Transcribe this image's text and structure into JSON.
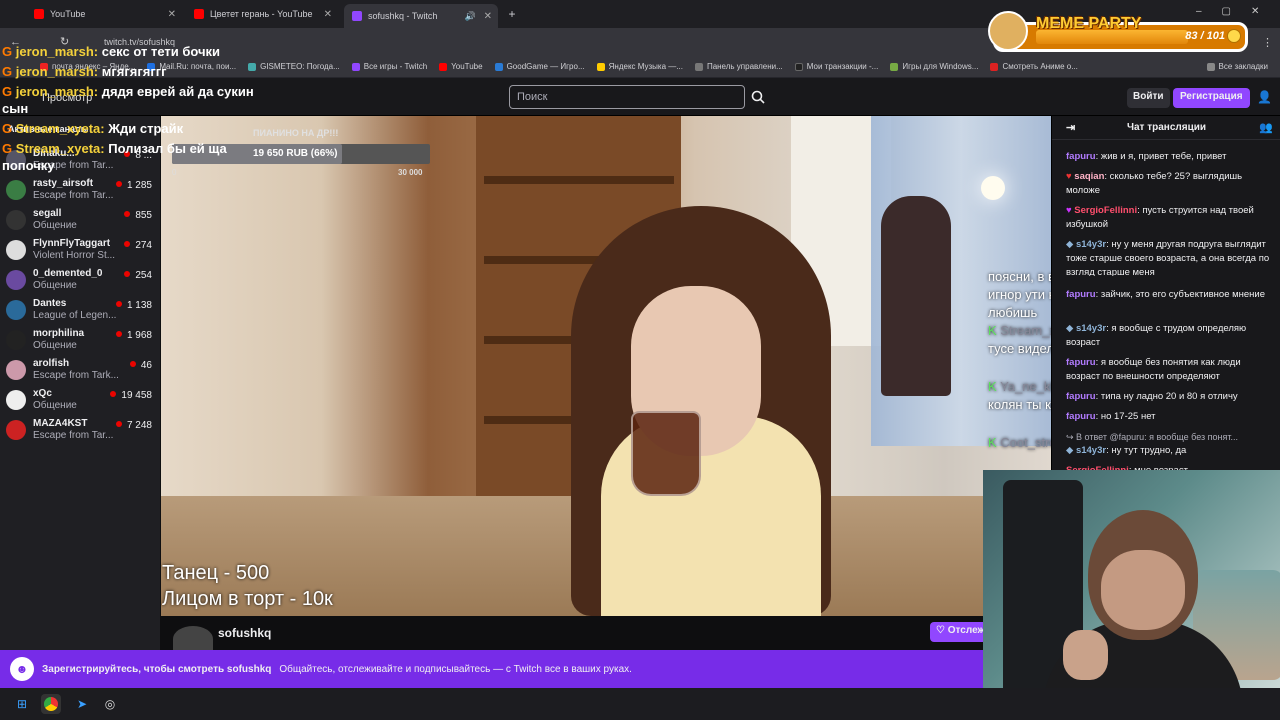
{
  "browser": {
    "tabs": [
      {
        "label": "YouTube"
      },
      {
        "label": "Цветет герань - YouTube"
      },
      {
        "label": "sofushkq - Twitch"
      }
    ],
    "url": "twitch.tv/sofushkq",
    "bookmarks": [
      "почта яндекс – Янде...",
      "Mail.Ru: почта, пои...",
      "GISMETEO: Погода...",
      "Все игры - Twitch",
      "YouTube",
      "GoodGame — Игро...",
      "Яндекс Музыка —...",
      "Панель управлени...",
      "Мои транзакции -...",
      "Игры для Windows...",
      "Смотреть Аниме о..."
    ],
    "all_bookmarks": "Все закладки"
  },
  "twitch": {
    "search_placeholder": "Поиск",
    "login": "Войти",
    "signup": "Регистрация",
    "sidebar_header": "Активные каналы",
    "sidebar_overlay_label": "Просмотр",
    "channels": [
      {
        "name": "Dinaku...",
        "game": "Escape from Tar...",
        "viewers": "8 ..."
      },
      {
        "name": "rasty_airsoft",
        "game": "Escape from Tar...",
        "viewers": "1 285"
      },
      {
        "name": "segall",
        "game": "Общение",
        "viewers": "855"
      },
      {
        "name": "FlynnFlyTaggart",
        "game": "Violent Horror St...",
        "viewers": "274"
      },
      {
        "name": "0_demented_0",
        "game": "Общение",
        "viewers": "254"
      },
      {
        "name": "Dantes",
        "game": "League of Legen...",
        "viewers": "1 138"
      },
      {
        "name": "morphilina",
        "game": "Общение",
        "viewers": "1 968"
      },
      {
        "name": "arolfish",
        "game": "Escape from Tark...",
        "viewers": "46"
      },
      {
        "name": "xQc",
        "game": "Общение",
        "viewers": "19 458"
      },
      {
        "name": "MAZA4KST",
        "game": "Escape from Tar...",
        "viewers": "7 248"
      }
    ],
    "chat_title": "Чат трансляции",
    "chat": [
      {
        "user": "fapuru",
        "text": ": жив и я, привет тебе, привет",
        "color": "#b27cff"
      },
      {
        "user": "saqian",
        "text": ": сколько тебе? 25? выглядишь моложе",
        "color": "#ffb3c7"
      },
      {
        "user": "SergioFellinni",
        "text": ": пусть струится над твоей избушкой",
        "color": "#ff4f6d"
      },
      {
        "user": "s14y3r",
        "text": ": ну у меня другая подруга выглядит тоже старше своего возраста, а она всегда по взгляд старше меня",
        "color": "#8fb4d8"
      },
      {
        "user": "fapuru",
        "text": ": зайчик, это его субъективное мнение",
        "color": "#b27cff"
      },
      {
        "user": "s14y3r",
        "text": ": я вообще с трудом определяю возраст",
        "color": "#8fb4d8"
      },
      {
        "user": "fapuru",
        "text": ": я вообще без понятия как люди возраст по внешности определяют",
        "color": "#b27cff"
      },
      {
        "user": "fapuru",
        "text": ": типа ну ладно 20 и 80 я отличу",
        "color": "#b27cff"
      },
      {
        "user": "fapuru",
        "text": ": но 17-25 нет",
        "color": "#b27cff"
      },
      {
        "user": "",
        "text": "В ответ @fapuru: я вообще без понят...",
        "color": "#adadb8"
      },
      {
        "user": "s14y3r",
        "text": ": ну тут трудно, да",
        "color": "#8fb4d8"
      },
      {
        "user": "SergioFellinni",
        "text": ": мне возраст",
        "color": "#ff4f6d"
      }
    ],
    "channel_name": "sofushkq",
    "follow": "Отслеживать",
    "banner_bold": "Зарегистрируйтесь, чтобы смотреть sofushkq",
    "banner_text": "Общайтесь, отслеживайте и подписывайтесь — с Twitch все в ваших руках."
  },
  "stream": {
    "goal_title": "ПИАНИНО НА ДР!!!",
    "goal_value": "19 650 RUB (66%)",
    "goal_progress": 0.66,
    "goal_min": "0",
    "goal_max": "30 000",
    "menu_line1": "Танец - 500",
    "menu_line2": "Лицом в торт - 10к",
    "right_overlay": [
      {
        "user": "",
        "text": "поясни, в в чём смысл игнор ути которую не любишь"
      },
      {
        "user": "Stream_xyeta",
        "text": "На аниме тусе виделись епт"
      },
      {
        "user": "Ya_ne_khochu_umeret",
        "text": "колян ты киборг"
      },
      {
        "user": "Coot_streamhub_shop",
        "text": ""
      }
    ]
  },
  "overlay_chat": [
    {
      "user": "jeron_marsh:",
      "text": " секс от тети бочки"
    },
    {
      "user": "jeron_marsh:",
      "text": " мгягягяггг"
    },
    {
      "user": "jeron_marsh:",
      "text": " дядя еврей ай да сукин"
    },
    {
      "user": "",
      "text": "сын"
    },
    {
      "user": "Stream_xyeta:",
      "text": " Жди страйк"
    },
    {
      "user": "Stream_xyeta:",
      "text": " Полизал бы ей ща"
    },
    {
      "user": "",
      "text": "попочку"
    }
  ],
  "meme_party": {
    "title": "MEME PARTY",
    "count": "83 / 101",
    "progress": 0.82
  },
  "colors": {
    "twitch_purple": "#9147ff",
    "banner_purple": "#772ce8",
    "live_red": "#eb0400"
  }
}
